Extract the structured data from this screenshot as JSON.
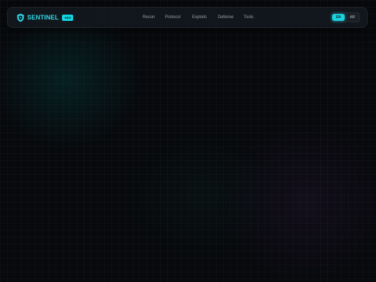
{
  "brand": {
    "name": "SENTINEL",
    "badge": "AEO",
    "logo_icon": "shield-icon",
    "accent_color": "#18d4e2"
  },
  "nav": {
    "items": [
      {
        "label": "Recon"
      },
      {
        "label": "Protocol"
      },
      {
        "label": "Exploits"
      },
      {
        "label": "Defense"
      },
      {
        "label": "Tools"
      }
    ]
  },
  "language": {
    "options": [
      "EN",
      "AR"
    ],
    "selected": "EN"
  },
  "colors": {
    "background": "#07090c",
    "navbar": "#12181e",
    "nav_text": "#9aa4ae"
  }
}
